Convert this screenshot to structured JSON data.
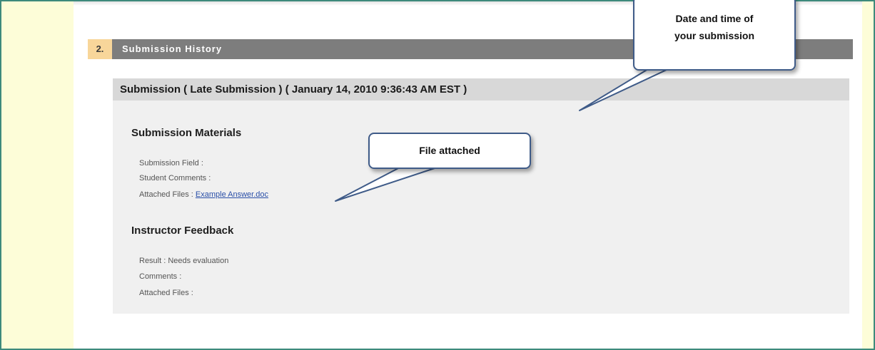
{
  "section": {
    "number": "2.",
    "title": "Submission History"
  },
  "submission": {
    "header": "Submission ( Late Submission ) ( January 14, 2010 9:36:43 AM EST )",
    "materials": {
      "title": "Submission Materials",
      "field_label": "Submission Field :",
      "comments_label": "Student Comments :",
      "files_label": "Attached Files :",
      "file_link": "Example Answer.doc"
    },
    "feedback": {
      "title": "Instructor Feedback",
      "result_label": "Result :",
      "result_value": "Needs evaluation",
      "comments_label": "Comments :",
      "files_label": "Attached Files :"
    }
  },
  "callouts": {
    "date": {
      "line1": "Date and time of",
      "line2": "your submission"
    },
    "file": {
      "text": "File attached"
    }
  },
  "colors": {
    "frame_border": "#3d8a7c",
    "side_strip": "#fdfdd8",
    "section_bar": "#7d7d7d",
    "section_number_bg": "#f8d69a",
    "link": "#2a4fa8",
    "callout_border": "#3f5b88"
  }
}
